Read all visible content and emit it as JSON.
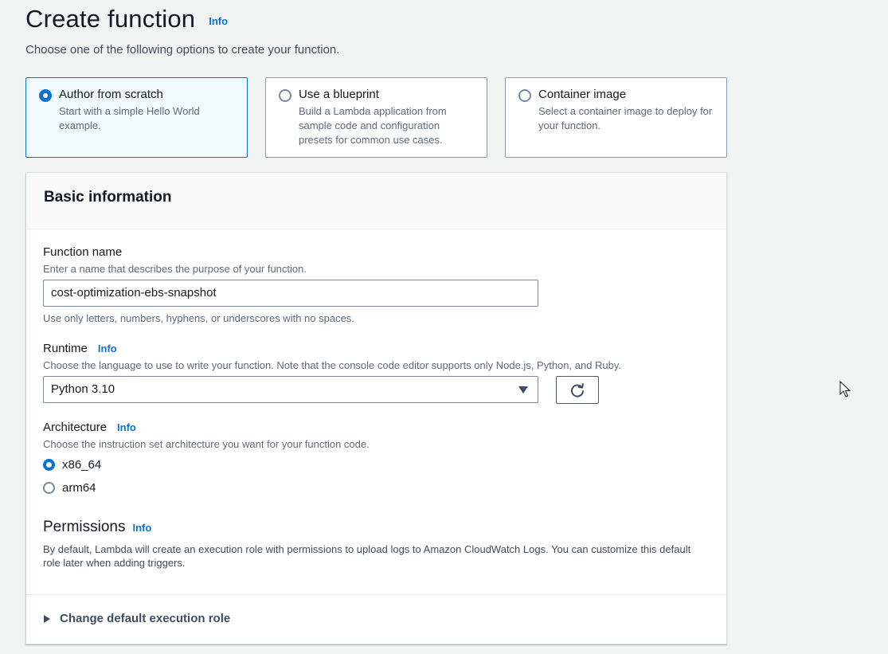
{
  "header": {
    "title": "Create function",
    "info_label": "Info",
    "description": "Choose one of the following options to create your function."
  },
  "options": [
    {
      "title": "Author from scratch",
      "description": "Start with a simple Hello World example.",
      "selected": true
    },
    {
      "title": "Use a blueprint",
      "description": "Build a Lambda application from sample code and configuration presets for common use cases.",
      "selected": false
    },
    {
      "title": "Container image",
      "description": "Select a container image to deploy for your function.",
      "selected": false
    }
  ],
  "basic_info": {
    "title": "Basic information",
    "function_name": {
      "label": "Function name",
      "description": "Enter a name that describes the purpose of your function.",
      "value": "cost-optimization-ebs-snapshot",
      "constraint": "Use only letters, numbers, hyphens, or underscores with no spaces."
    },
    "runtime": {
      "label": "Runtime",
      "info_label": "Info",
      "description": "Choose the language to use to write your function. Note that the console code editor supports only Node.js, Python, and Ruby.",
      "selected": "Python 3.10"
    },
    "architecture": {
      "label": "Architecture",
      "info_label": "Info",
      "description": "Choose the instruction set architecture you want for your function code.",
      "options": [
        {
          "label": "x86_64",
          "selected": true
        },
        {
          "label": "arm64",
          "selected": false
        }
      ]
    },
    "permissions": {
      "title": "Permissions",
      "info_label": "Info",
      "description": "By default, Lambda will create an execution role with permissions to upload logs to Amazon CloudWatch Logs. You can customize this default role later when adding triggers."
    },
    "expander_label": "Change default execution role"
  },
  "colors": {
    "accent": "#0972d3",
    "selected_tile_bg": "#f1faff",
    "page_bg": "#f2f3f3"
  }
}
